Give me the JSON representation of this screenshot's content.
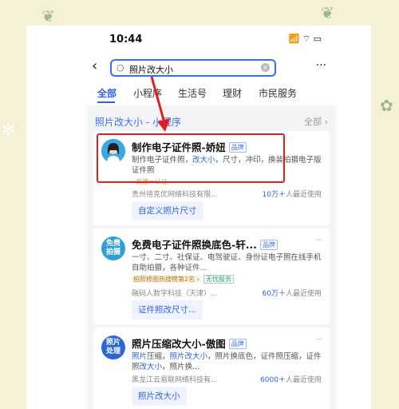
{
  "status_bar": {
    "time": "10:44",
    "icons": "📶 ⌔ ▭"
  },
  "search": {
    "back": "‹",
    "query": "照片改大小",
    "more": "···"
  },
  "tabs": [
    {
      "label": "全部",
      "active": true
    },
    {
      "label": "小程序",
      "active": false
    },
    {
      "label": "生活号",
      "active": false
    },
    {
      "label": "理财",
      "active": false
    },
    {
      "label": "市民服务",
      "active": false
    }
  ],
  "section": {
    "title": "照片改大小 - 小程序",
    "more": "全部 ›"
  },
  "results": [
    {
      "title": "制作电子证件照-娇妞",
      "badge": "品牌",
      "desc_pre": "制作电子证件照，",
      "desc_hl": "改大小",
      "desc_post": "，尺寸，冲印，换装拍摄电子版证件照",
      "tag_line": "· 高德一认证",
      "company": "贵州待克优网络科技有限...",
      "users_num": "10万＋",
      "users_suffix": "人最近使用",
      "action": "自定义照片尺寸"
    },
    {
      "icon_text": "免费拍摄",
      "title": "免费电子证件照换底色-轩...",
      "badge": "品牌",
      "desc": "一寸、二寸、社保证、电驾驶证、身份证电子照在线手机自助拍摄，各种证件...",
      "tag_rank": "拍照修图热搜榜第2名 ›",
      "tag_plain": "无忧服务",
      "company": "融码人数字科技（天津）...",
      "users_num": "60万＋",
      "users_suffix": "人最近使用",
      "action": "证件照改尺寸..."
    },
    {
      "icon_text": "照片处理",
      "title": "照片压缩改大小-傲图",
      "badge": "品牌",
      "desc_hl1": "照片",
      "desc_1": "压缩，",
      "desc_hl2": "照片改大小",
      "desc_2": "，照片换底色，证件照压缩，证件照",
      "desc_hl3": "改大小",
      "desc_3": "，照片换...",
      "company": "黑龙江云易联网络科技有...",
      "users_num": "6000＋",
      "users_suffix": "人最近使用",
      "action": "照片改大小"
    }
  ],
  "colors": {
    "accent": "#2e63e6",
    "highlight_box": "#e02020",
    "background": "#f4f1d6"
  }
}
